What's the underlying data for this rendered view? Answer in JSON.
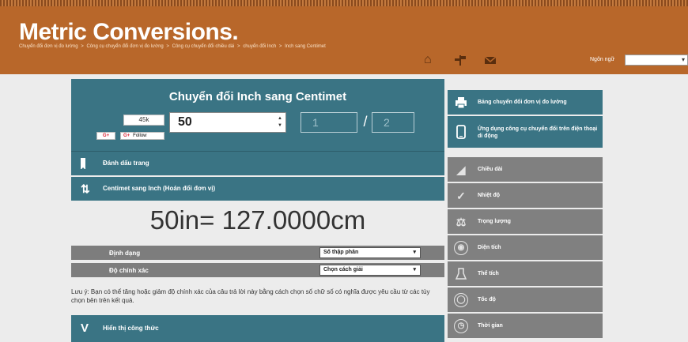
{
  "header": {
    "logo": "Metric Conversions.",
    "breadcrumb": [
      "Chuyển đổi đơn vị đo lường",
      ">",
      "Công cụ chuyển đổi đơn vị đo lường",
      ">",
      "Công cụ chuyển đổi chiều dài",
      ">",
      "chuyển đổi Inch",
      ">",
      "Inch sang Centimet"
    ],
    "icons": [
      "home-icon",
      "signpost-icon",
      "mail-icon"
    ],
    "language_label": "Ngôn ngữ",
    "language_value": ""
  },
  "converter": {
    "title": "Chuyển đổi Inch sang Centimet",
    "share_count": "45k",
    "gplus_label": "G+",
    "follow_g": "G+",
    "follow_label": "Follow",
    "input_value": "50",
    "fraction_numerator": "1",
    "fraction_separator": "/",
    "fraction_denominator": "2"
  },
  "bars": {
    "bookmark": "Đánh dấu trang",
    "swap": "Centimet sang Inch (Hoán đổi đơn vị)",
    "formula_letter": "V",
    "formula": "Hiển thị công thức"
  },
  "result": "50in= 127.0000cm",
  "options": {
    "format_label": "Định dạng",
    "format_value": "Số thập phân",
    "precision_label": "Độ chính xác",
    "precision_value": "Chọn cách giải"
  },
  "note": "Lưu ý: Bạn có thể tăng hoặc giảm độ chính xác của câu trả lời này bằng cách chọn số chữ số có nghĩa được yêu cầu từ các tùy chọn bên trên kết quả.",
  "sidebar": [
    {
      "label": "Bảng chuyển đổi đơn vị đo lường",
      "icon": "printer-icon",
      "highlight": true
    },
    {
      "label": "Ứng dụng công cụ chuyển đổi trên điện thoại di động",
      "icon": "mobile-icon",
      "highlight": true
    },
    {
      "label": "Chiều dài",
      "icon": "ruler-icon",
      "highlight": false
    },
    {
      "label": "Nhiệt độ",
      "icon": "thermometer-icon",
      "highlight": false
    },
    {
      "label": "Trọng lượng",
      "icon": "scale-icon",
      "highlight": false
    },
    {
      "label": "Diện tích",
      "icon": "globe-icon",
      "highlight": false
    },
    {
      "label": "Thể tích",
      "icon": "beaker-icon",
      "highlight": false
    },
    {
      "label": "Tốc độ",
      "icon": "speedometer-icon",
      "highlight": false
    },
    {
      "label": "Thời gian",
      "icon": "clock-icon",
      "highlight": false
    }
  ],
  "colors": {
    "header": "#b8672a",
    "teal": "#3a7484",
    "gray": "#808080"
  }
}
